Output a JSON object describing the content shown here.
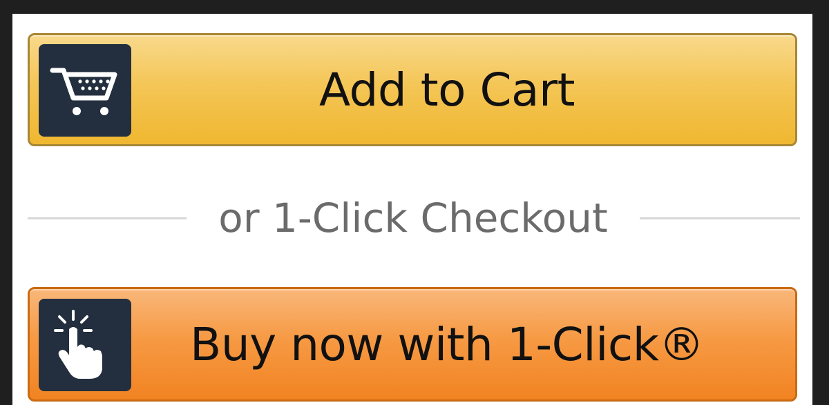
{
  "add_to_cart": {
    "label": "Add to Cart",
    "icon": "shopping-cart-icon",
    "colors": {
      "top": "#f8d98c",
      "bottom": "#f0b730",
      "border": "#a88734"
    }
  },
  "divider": {
    "label": "or 1-Click Checkout"
  },
  "buy_now": {
    "label": "Buy now with 1-Click®",
    "icon": "pointer-click-icon",
    "colors": {
      "top": "#f9b77a",
      "bottom": "#f28322",
      "border": "#ca6a12"
    }
  },
  "icon_background": "#232f3e"
}
